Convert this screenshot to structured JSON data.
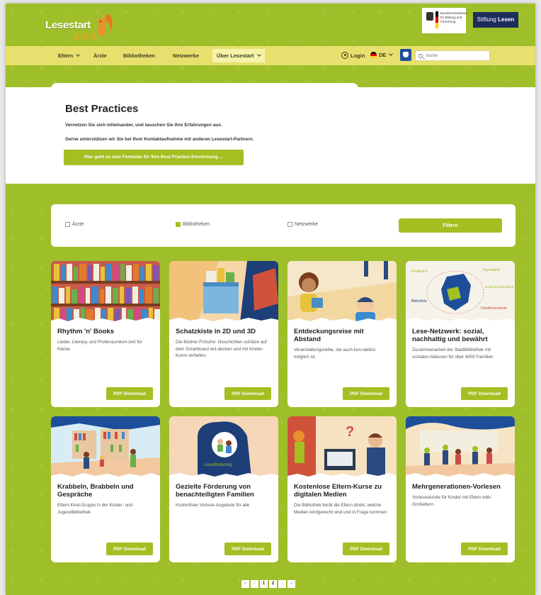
{
  "header": {
    "logo_text": "Lesestart",
    "logo_number": "1-2-3",
    "gov_logo_text": "Bundesministerium für Bildung und Forschung",
    "stiftung_logo": {
      "prefix": "Stiftung ",
      "suffix": "Lesen"
    }
  },
  "nav": {
    "items": [
      {
        "label": "Eltern",
        "has_dropdown": true
      },
      {
        "label": "Ärzte",
        "has_dropdown": false
      },
      {
        "label": "Bibliotheken",
        "has_dropdown": false
      },
      {
        "label": "Netzwerke",
        "has_dropdown": false
      },
      {
        "label": "Über Lesestart",
        "has_dropdown": true
      }
    ],
    "login_label": "Login",
    "lang_label": "DE",
    "search_placeholder": "Suche"
  },
  "intro": {
    "title": "Best Practices",
    "line1": "Vernetzen Sie sich miteinander, und tauschen Sie Ihre Erfahrungen aus.",
    "line2": "Gerne unterstützen wir Sie bei Ihrer Kontaktaufnahme mit anderen Lesestart-Partnern.",
    "cta_label": "Hier geht es zum Formular für Ihre Best Practice-Einreichung ..."
  },
  "filter": {
    "options": [
      {
        "label": "Ärzte",
        "checked": false
      },
      {
        "label": "Bibliotheken",
        "checked": true
      },
      {
        "label": "Netzwerke",
        "checked": false
      }
    ],
    "button_label": "Filtern"
  },
  "cards": [
    {
      "title": "Rhythm 'n' Books",
      "desc": "Lieder, Literacy und Proberaumkon-zert für Kleine.",
      "button": "PDF Download"
    },
    {
      "title": "Schatzkiste in 2D und 3D",
      "desc": "Die Bücher-Frösche: Geschichten-schätze auf dem Smartboard ent-decken und mit Kinder-Kunst vertiefen.",
      "button": "PDF Download"
    },
    {
      "title": "Entdeckungsreise mit Abstand",
      "desc": "Veranstaltungsreihe, die auch kon-taktlos möglich ist.",
      "button": "PDF Download"
    },
    {
      "title": "Lese-Netzwerk: sozial, nachhaltig und bewährt",
      "desc": "Zusammenarbeit der Stadtbibliothek mit sozialen Akteuren für über 4000 Familien",
      "button": "PDF Download"
    },
    {
      "title": "Krabbeln, Brabbeln und Gespräche",
      "desc": "Eltern-Kind-Gruppe in der Kinder- und Jugendbibliothek",
      "button": "PDF Download"
    },
    {
      "title": "Gezielte Förderung von benachteiligten Familien",
      "desc": "Kostenfreie Vorlese-Angebote für alle",
      "button": "PDF Download"
    },
    {
      "title": "Kostenlose Eltern-Kurse zu digitalen Medien",
      "desc": "Die Bibliothek berät die Eltern direkt, welche Medien kindgerecht sind und in Frage kommen",
      "button": "PDF Download"
    },
    {
      "title": "Mehrgenerationen-Vorlesen",
      "desc": "Vorlesestunde für Kinder mit Eltern oder Großeltern",
      "button": "PDF Download"
    }
  ],
  "card4_image_labels": {
    "a": "Kinderarzt",
    "b": "Jugendamt",
    "c": "Bibliothek",
    "d": "Familienzentrum",
    "e": "Erziehungsberatung"
  },
  "card6_image_label": "Leseförderung",
  "pagination": {
    "first": "«",
    "prev": "‹",
    "pages": [
      "1",
      "2"
    ],
    "next": "›",
    "last": "»",
    "current": "1"
  },
  "colors": {
    "accent": "#a3bf22",
    "background": "#9fbf2a",
    "nav": "#e7e06e"
  }
}
